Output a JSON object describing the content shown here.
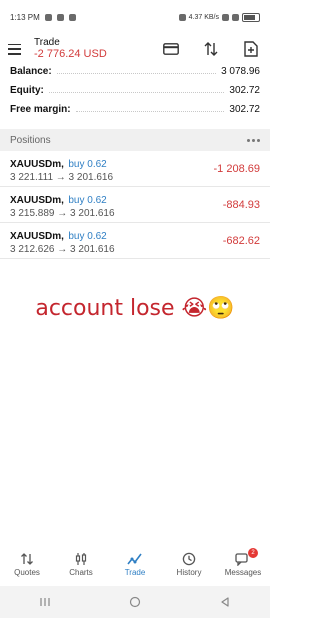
{
  "status_bar": {
    "time": "1:13 PM",
    "right_text": "4.37 KB/s"
  },
  "header": {
    "title": "Trade",
    "profit": "-2 776.24 USD"
  },
  "account": [
    {
      "label": "Balance:",
      "value": "3 078.96"
    },
    {
      "label": "Equity:",
      "value": "302.72"
    },
    {
      "label": "Free margin:",
      "value": "302.72"
    }
  ],
  "positions": {
    "title": "Positions",
    "items": [
      {
        "symbol": "XAUUSDm,",
        "side": "buy 0.62",
        "prices": "3 221.111 → 3 201.616",
        "profit": "-1 208.69"
      },
      {
        "symbol": "XAUUSDm,",
        "side": "buy 0.62",
        "prices": "3 215.889 → 3 201.616",
        "profit": "-884.93"
      },
      {
        "symbol": "XAUUSDm,",
        "side": "buy 0.62",
        "prices": "3 212.626 → 3 201.616",
        "profit": "-682.62"
      }
    ]
  },
  "caption": "account lose 😭🙄",
  "nav": {
    "items": [
      {
        "label": "Quotes",
        "icon": "quotes-icon"
      },
      {
        "label": "Charts",
        "icon": "charts-icon"
      },
      {
        "label": "Trade",
        "icon": "trade-icon"
      },
      {
        "label": "History",
        "icon": "history-icon"
      },
      {
        "label": "Messages",
        "icon": "messages-icon"
      }
    ],
    "active": "Trade",
    "messages_badge": "2"
  },
  "colors": {
    "accent": "#2f7fc4",
    "loss": "#d23b3b",
    "caption": "#c4262e"
  }
}
